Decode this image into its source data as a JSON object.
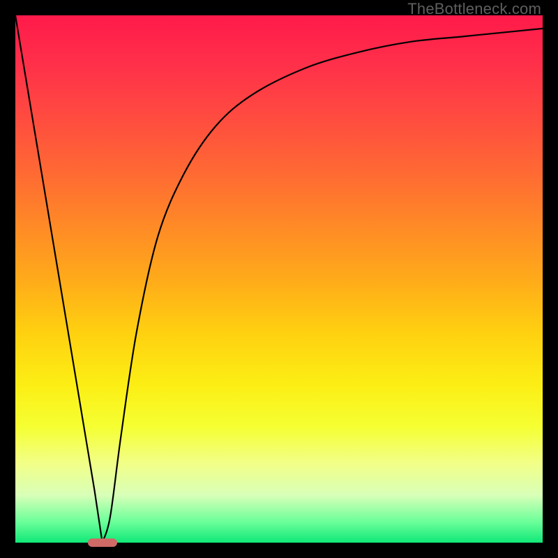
{
  "attribution": "TheBottleneck.com",
  "chart_data": {
    "type": "line",
    "title": "",
    "xlabel": "",
    "ylabel": "",
    "xlim": [
      0,
      100
    ],
    "ylim": [
      0,
      100
    ],
    "grid": false,
    "legend": false,
    "series": [
      {
        "name": "bottleneck-curve",
        "x": [
          0,
          5,
          10,
          15,
          16.5,
          18,
          20,
          23,
          27,
          32,
          38,
          45,
          55,
          65,
          75,
          85,
          95,
          100
        ],
        "y": [
          100,
          70,
          40,
          10,
          0,
          5,
          20,
          40,
          58,
          70,
          79,
          85,
          90,
          93,
          95,
          96,
          97,
          97.5
        ]
      }
    ],
    "marker": {
      "x": 16.5,
      "y": 0,
      "width_pct": 5.5,
      "height_pct": 1.6
    },
    "background_gradient": {
      "stops": [
        {
          "pct": 0,
          "color": "#ff1a4a"
        },
        {
          "pct": 50,
          "color": "#ffaa1a"
        },
        {
          "pct": 78,
          "color": "#f5ff32"
        },
        {
          "pct": 100,
          "color": "#10e878"
        }
      ]
    }
  }
}
